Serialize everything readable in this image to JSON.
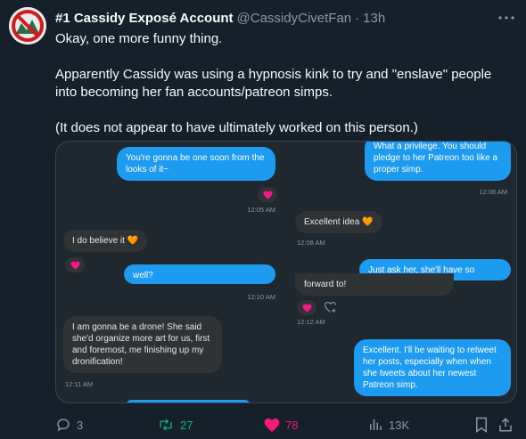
{
  "tweet": {
    "author_name": "#1 Cassidy Exposé Account",
    "handle": "@CassidyCivetFan",
    "separator": "·",
    "time": "13h",
    "text": {
      "line1": "Okay, one more funny thing.",
      "line2": "Apparently Cassidy was using a hypnosis kink to try and \"enslave\" people into becoming her fan accounts/patreon simps.",
      "line3": "(It does not appear to have ultimately worked on this person.)"
    }
  },
  "media": {
    "left": {
      "msg1": "You're gonna be one soon from the looks of it~",
      "ts1": "12:05 AM",
      "msg2": "I do believe it 🧡",
      "msg3_partial": "well?",
      "ts3": "12:10 AM",
      "msg4": "I am gonna be a drone! She said she'd organize more art for us, first and foremost, me finishing up my dronification!",
      "ts4": "12:11 AM"
    },
    "right": {
      "msg1_partial": "What a privilege. You should pledge to her Patreon too like a proper simp.",
      "ts1": "12:08 AM",
      "msg2": "Excellent idea 🧡",
      "ts2": "12:08 AM",
      "msg3_partial": "Just ask her, she'll have so",
      "msg4_partial": "forward to!",
      "ts4": "12:12 AM",
      "msg5": "Excellent. I'll be waiting to retweet her posts, especially when when she tweets about her newest Patreon simp."
    },
    "reaction_emoji": "❤️"
  },
  "actions": {
    "replies": "3",
    "retweets": "27",
    "likes": "78",
    "views": "13K"
  },
  "colors": {
    "background": "#15202b",
    "retweet": "#00ba7c",
    "like": "#f91880",
    "bubble_blue": "#1d9bf0"
  },
  "icons": [
    "more-icon",
    "reply-icon",
    "retweet-icon",
    "like-icon",
    "views-icon",
    "bookmark-icon",
    "share-icon"
  ]
}
